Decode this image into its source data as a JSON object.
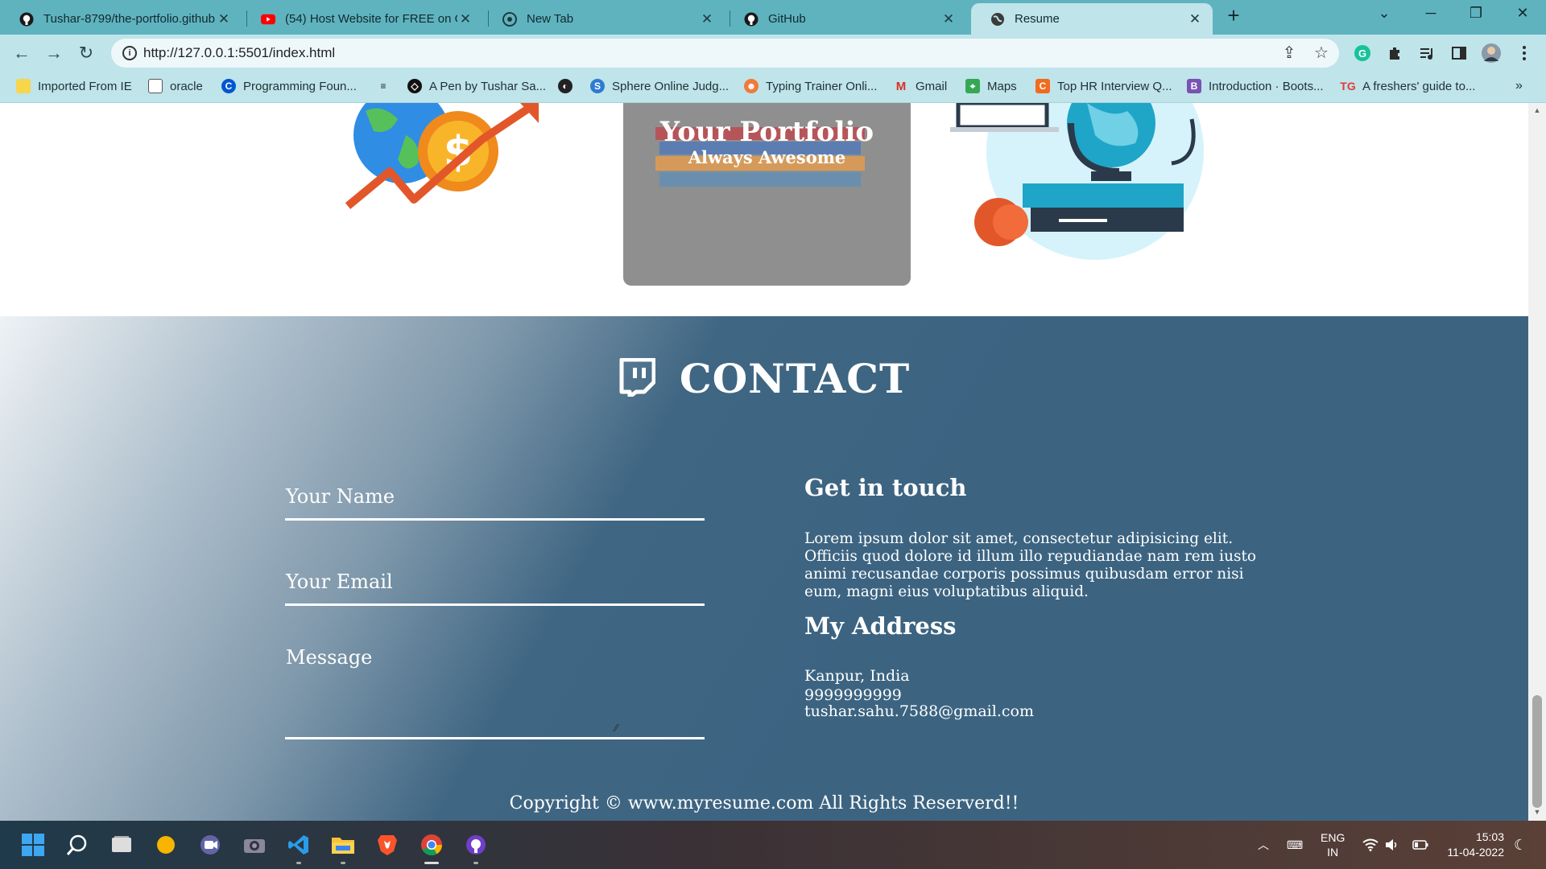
{
  "browser": {
    "tabs": [
      {
        "title": "Tushar-8799/the-portfolio.github",
        "icon": "github-icon",
        "active": false
      },
      {
        "title": "(54) Host Website for FREE on Gi",
        "icon": "youtube-icon",
        "active": false
      },
      {
        "title": "New Tab",
        "icon": "chrome-icon",
        "active": false
      },
      {
        "title": "GitHub",
        "icon": "github-icon",
        "active": false
      },
      {
        "title": "Resume",
        "icon": "globe-icon",
        "active": true
      }
    ],
    "url": "http://127.0.0.1:5501/index.html",
    "bookmarks": [
      {
        "label": "Imported From IE",
        "icon": "folder-icon"
      },
      {
        "label": "oracle",
        "icon": "page-icon"
      },
      {
        "label": "Programming Foun...",
        "icon": "coursera-icon"
      },
      {
        "label": "",
        "icon": "stack-icon"
      },
      {
        "label": "A Pen by Tushar Sa...",
        "icon": "codepen-icon"
      },
      {
        "label": "",
        "icon": "globe-icon"
      },
      {
        "label": "Sphere Online Judg...",
        "icon": "spoj-icon"
      },
      {
        "label": "Typing Trainer Onli...",
        "icon": "typing-icon"
      },
      {
        "label": "Gmail",
        "icon": "gmail-icon"
      },
      {
        "label": "Maps",
        "icon": "maps-icon"
      },
      {
        "label": "Top HR Interview Q...",
        "icon": "c-icon"
      },
      {
        "label": "Introduction · Boots...",
        "icon": "bootstrap-icon"
      },
      {
        "label": "A freshers' guide to...",
        "icon": "tg-icon"
      }
    ],
    "more_bookmarks": "»"
  },
  "page": {
    "portfolio_card": {
      "title": "Your Portfolio",
      "subtitle": "Always Awesome"
    },
    "contact": {
      "heading": "CONTACT",
      "heading_icon": "twitch-icon",
      "form": {
        "name_placeholder": "Your Name",
        "email_placeholder": "Your Email",
        "message_placeholder": "Message"
      },
      "get_in_touch": {
        "title": "Get in touch",
        "body": "Lorem ipsum dolor sit amet, consectetur adipisicing elit. Officiis quod dolore id illum illo repudiandae nam rem iusto animi recusandae corporis possimus quibusdam error nisi eum, magni eius voluptatibus aliquid."
      },
      "address": {
        "title": "My Address",
        "city": "Kanpur, India",
        "phone": "9999999999",
        "email": "tushar.sahu.7588@gmail.com"
      }
    },
    "copyright": "Copyright © www.myresume.com All Rights Reserverd!!"
  },
  "taskbar": {
    "apps": [
      "windows-start-icon",
      "search-icon",
      "task-view-icon",
      "widget-icon",
      "teams-icon",
      "camera-icon",
      "vscode-icon",
      "file-explorer-icon",
      "brave-icon",
      "chrome-icon",
      "github-desktop-icon"
    ],
    "language": "ENG",
    "region": "IN",
    "time": "15:03",
    "date": "11-04-2022"
  },
  "colors": {
    "tab_strip": "#5fb3bf",
    "toolbar": "#bfe4ea",
    "contact_bg": "#3c6481"
  }
}
